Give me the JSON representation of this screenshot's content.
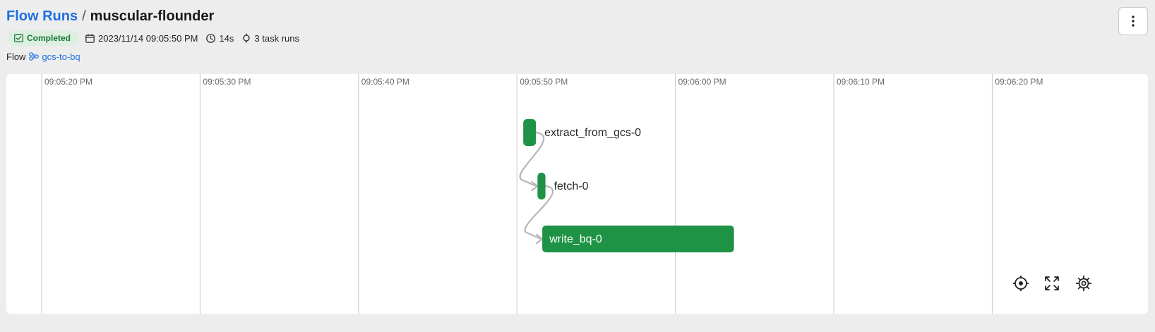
{
  "breadcrumb": {
    "root": "Flow Runs",
    "separator": "/",
    "current": "muscular-flounder"
  },
  "run": {
    "state": "Completed",
    "start_time": "2023/11/14 09:05:50 PM",
    "duration": "14s",
    "task_runs": "3 task runs"
  },
  "flow": {
    "label": "Flow",
    "name": "gcs-to-bq"
  },
  "timeline": {
    "ticks": [
      "09:05:20 PM",
      "09:05:30 PM",
      "09:05:40 PM",
      "09:05:50 PM",
      "09:06:00 PM",
      "09:06:10 PM",
      "09:06:20 PM"
    ],
    "tasks": [
      {
        "name": "extract_from_gcs-0",
        "start_offset_s": 0.4,
        "duration_s": 0.8
      },
      {
        "name": "fetch-0",
        "start_offset_s": 1.3,
        "duration_s": 0.5
      },
      {
        "name": "write_bq-0",
        "start_offset_s": 1.6,
        "duration_s": 12.1
      }
    ],
    "first_tick_epoch_offset_s": -30,
    "seconds_per_tick": 10
  },
  "colors": {
    "accent": "#1f6fe0",
    "task_completed": "#1e9345",
    "badge_bg": "#dcefe1",
    "badge_fg": "#1b7a38",
    "grid": "#c7c7c7",
    "dependency": "#b5b5bd"
  },
  "icons": {
    "menu": "kebab-vertical-icon",
    "state": "check-square-icon",
    "calendar": "calendar-icon",
    "clock": "clock-icon",
    "task": "task-node-icon",
    "flow": "flow-icon",
    "recenter": "crosshair-icon",
    "fullscreen": "expand-icon",
    "settings": "gear-icon"
  }
}
